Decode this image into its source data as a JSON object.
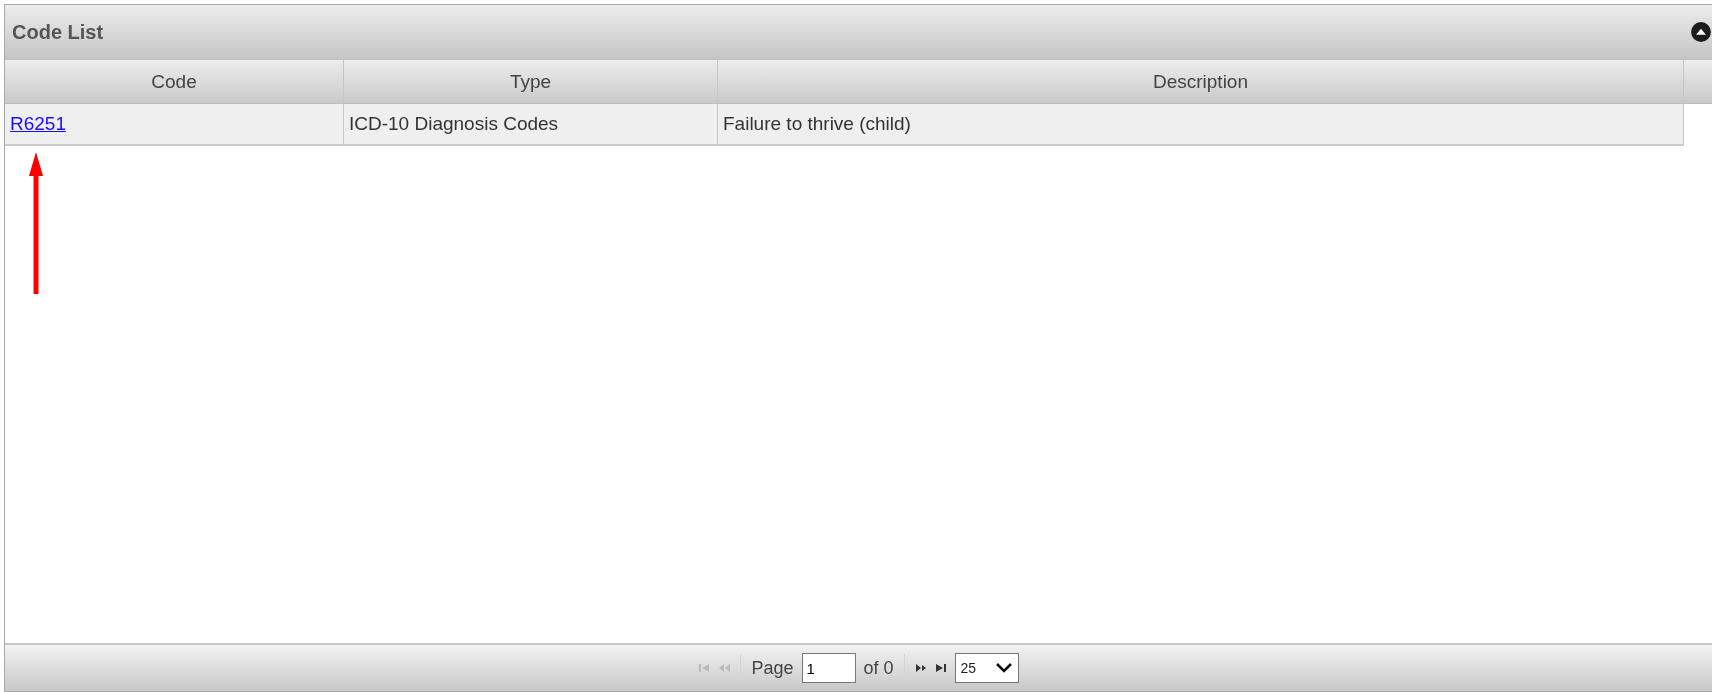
{
  "panel": {
    "title": "Code List"
  },
  "table": {
    "columns": [
      "Code",
      "Type",
      "Description"
    ],
    "rows": [
      {
        "code": "R6251",
        "type": "ICD-10 Diagnosis Codes",
        "description": "Failure to thrive (child)"
      }
    ]
  },
  "pager": {
    "buttons": [
      {
        "kind": "first",
        "disabled": true
      },
      {
        "kind": "prev",
        "disabled": true
      }
    ],
    "page_label": "Page",
    "page_value": "1",
    "of_label": "of 0",
    "buttons_after": [
      {
        "kind": "next",
        "disabled": false
      },
      {
        "kind": "last",
        "disabled": false
      }
    ],
    "page_size": "25"
  }
}
